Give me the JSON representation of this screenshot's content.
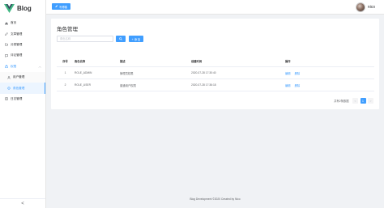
{
  "brand": {
    "name": "Blog",
    "accent": "#409eff",
    "logo_colors": [
      "#41b883",
      "#35495e"
    ]
  },
  "sidebar": {
    "items": [
      {
        "label": "首页",
        "icon": "home-icon"
      },
      {
        "label": "文章管理",
        "icon": "edit-icon"
      },
      {
        "label": "分类管理",
        "icon": "folder-icon"
      },
      {
        "label": "评论管理",
        "icon": "comment-icon"
      },
      {
        "label": "权限",
        "icon": "lock-icon"
      },
      {
        "label": "用户管理",
        "icon": "user-icon"
      },
      {
        "label": "角色管理",
        "icon": "role-icon"
      },
      {
        "label": "日志管理",
        "icon": "document-icon"
      }
    ],
    "collapse_label": "<"
  },
  "header": {
    "write_label": "写博客",
    "username": "nico"
  },
  "main": {
    "title": "角色管理",
    "search_placeholder": "角色名称",
    "add_label": "+ 添 加",
    "columns": [
      "序号",
      "角色名称",
      "描述",
      "创建时间",
      "操作"
    ],
    "rows": [
      {
        "idx": "1",
        "name": "ROLE_ADMIN",
        "desc": "管理员权限",
        "time": "2020-07-28 17:30:40",
        "edit": "编辑",
        "delete": "删除"
      },
      {
        "idx": "2",
        "name": "ROLE_USER",
        "desc": "普通用户权限",
        "time": "2020-07-28 17:36:18",
        "edit": "编辑",
        "delete": "删除"
      }
    ],
    "pagination": {
      "total_text": "共有2条数据",
      "prev": "<",
      "page": "1",
      "next": ">"
    }
  },
  "footer": {
    "text": "Blog Development ©2020 Created by Nico"
  }
}
